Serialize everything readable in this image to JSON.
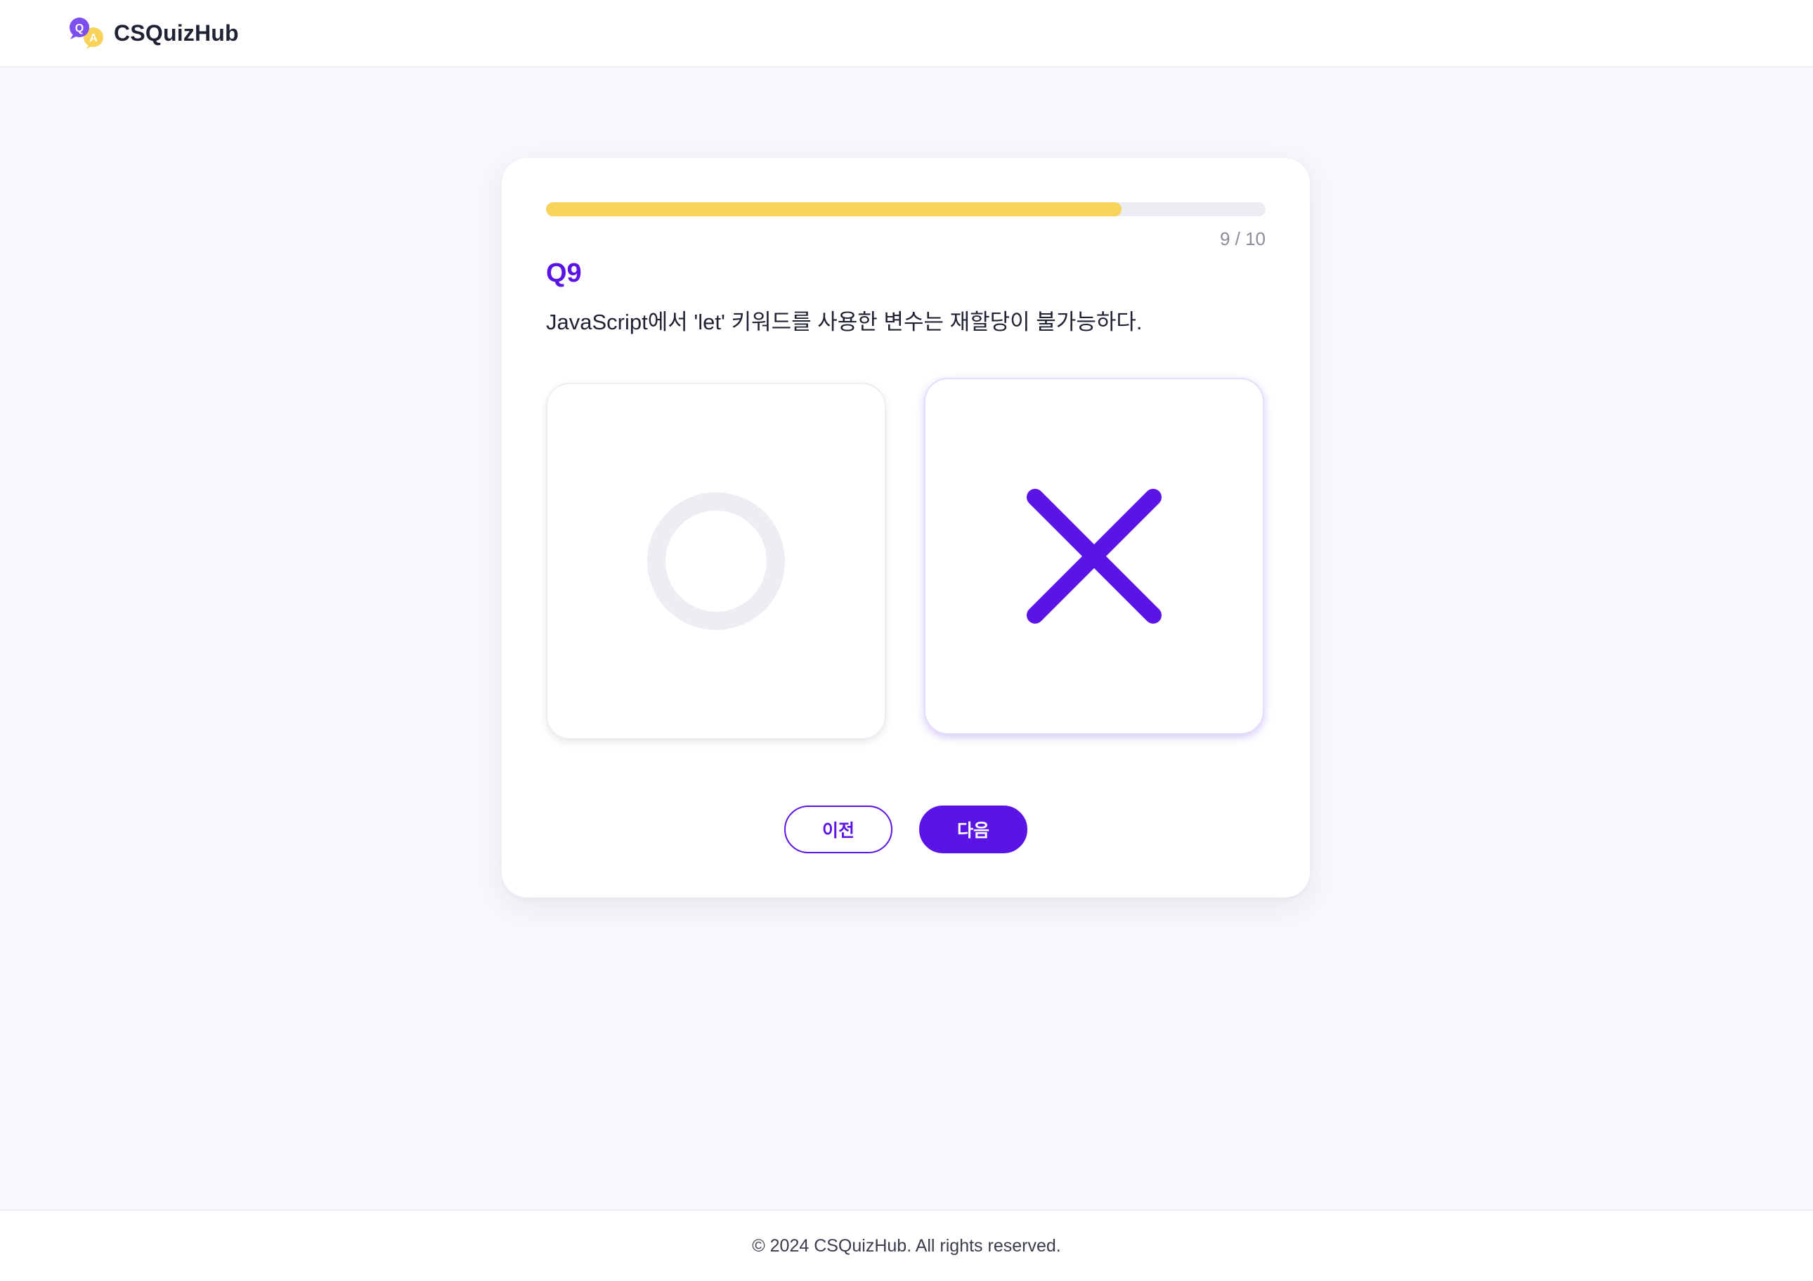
{
  "header": {
    "app_name": "CSQuizHub",
    "logo_icon": "q-a-chat-bubbles-icon"
  },
  "quiz": {
    "progress_text": "9 / 10",
    "progress_fraction": 0.8,
    "question_number": "Q9",
    "question_text": "JavaScript에서 'let' 키워드를 사용한 변수는 재할당이 불가능하다.",
    "options": [
      {
        "icon": "circle-o-icon",
        "selected": false
      },
      {
        "icon": "cross-x-icon",
        "selected": true
      }
    ],
    "prev_label": "이전",
    "next_label": "다음"
  },
  "footer": {
    "copyright": "© 2024 CSQuizHub. All rights reserved."
  },
  "colors": {
    "accent": "#5b14e6",
    "progress": "#f7d35a",
    "background": "#f7f8fc",
    "unselected_icon": "#eceef4"
  }
}
